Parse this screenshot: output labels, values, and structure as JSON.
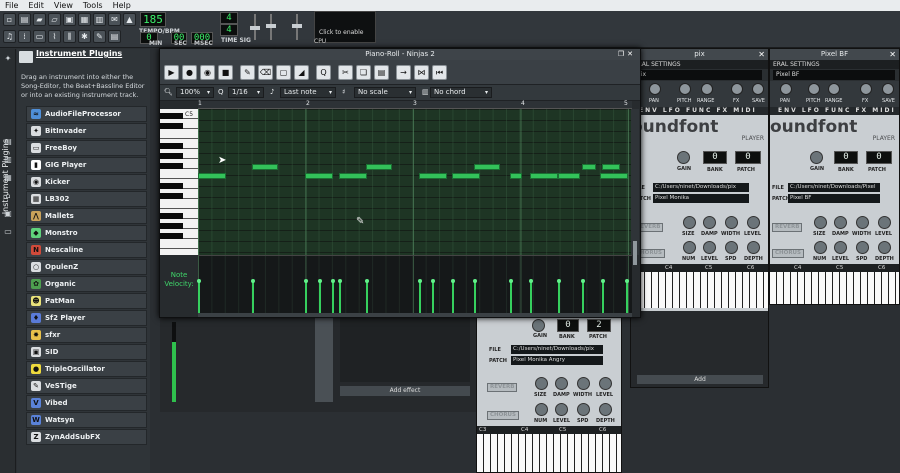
{
  "menu": [
    "File",
    "Edit",
    "View",
    "Tools",
    "Help"
  ],
  "transport": {
    "tempo": "185",
    "tempo_label": "TEMPO/BPM",
    "min": "0",
    "sec": "00",
    "msec": "000",
    "min_label": "MIN",
    "sec_label": "SEC",
    "msec_label": "MSEC",
    "timesig_num": "4",
    "timesig_den": "4",
    "timesig_label": "TIME SIG",
    "cpu_label": "CPU",
    "cpu_hint": "Click to enable"
  },
  "sidebar": {
    "tab_label": "Instrument Plugins"
  },
  "plugins": {
    "title": "Instrument Plugins",
    "description": "Drag an instrument into either the Song-Editor, the Beat+Bassline Editor or into an existing instrument track.",
    "items": [
      {
        "name": "AudioFileProcessor",
        "color": "#4f8fd8",
        "glyph": "≈"
      },
      {
        "name": "BitInvader",
        "color": "#dadde0",
        "glyph": "✦"
      },
      {
        "name": "FreeBoy",
        "color": "#dadde0",
        "glyph": "▭"
      },
      {
        "name": "GIG Player",
        "color": "#ffffff",
        "glyph": "▮"
      },
      {
        "name": "Kicker",
        "color": "#dadde0",
        "glyph": "◉"
      },
      {
        "name": "LB302",
        "color": "#dadde0",
        "glyph": "▦"
      },
      {
        "name": "Mallets",
        "color": "#c9a25a",
        "glyph": "⋀"
      },
      {
        "name": "Monstro",
        "color": "#5fd27b",
        "glyph": "◆"
      },
      {
        "name": "Nescaline",
        "color": "#d04a3a",
        "glyph": "N"
      },
      {
        "name": "OpulenZ",
        "color": "#dadde0",
        "glyph": "○"
      },
      {
        "name": "Organic",
        "color": "#4d9f4f",
        "glyph": "✿"
      },
      {
        "name": "PatMan",
        "color": "#e9e27a",
        "glyph": "☻"
      },
      {
        "name": "Sf2 Player",
        "color": "#5a7bd8",
        "glyph": "♦"
      },
      {
        "name": "sfxr",
        "color": "#e8c14a",
        "glyph": "✸"
      },
      {
        "name": "SID",
        "color": "#dadde0",
        "glyph": "▣"
      },
      {
        "name": "TripleOscillator",
        "color": "#eeda3d",
        "glyph": "●"
      },
      {
        "name": "VeSTige",
        "color": "#dadde0",
        "glyph": "✎"
      },
      {
        "name": "Vibed",
        "color": "#5a82d8",
        "glyph": "V"
      },
      {
        "name": "Watsyn",
        "color": "#5a82d8",
        "glyph": "W"
      },
      {
        "name": "ZynAddSubFX",
        "color": "#dadde0",
        "glyph": "Z"
      }
    ]
  },
  "piano_roll": {
    "title": "Piano-Roll - Ninjas 2",
    "zoom": "100%",
    "quantize": "1/16",
    "note_length": "Last note",
    "scale": "No scale",
    "chord": "No chord",
    "ruler": [
      "1",
      "2",
      "3",
      "4",
      "5"
    ],
    "key_label": "C5",
    "velocity_label": "Note Velocity:"
  },
  "sf2_windows": [
    {
      "title": "pix",
      "file": "C:/Users/ninet/Downloads/pix",
      "patch": "Pixel Monika",
      "name": "pix"
    },
    {
      "title": "Pixel BF",
      "file": "C:/Users/ninet/Downloads/Pixel BF",
      "patch": "Pixel BF",
      "name": "Pixel BF"
    },
    {
      "title": "",
      "file": "C:/Users/ninet/Downloads/pix",
      "patch": "Pixel Monika Angry",
      "name": ""
    }
  ],
  "sf2": {
    "gen_settings": "ERAL SETTINGS",
    "logo": "oundfont",
    "logo_sub": "PLAYER",
    "knob_labels": [
      "PAN",
      "PITCH",
      "RANGE",
      "FX",
      "SAVE"
    ],
    "lcd_bank": "0",
    "lcd_patch": "0",
    "lcd_patch_2": "2",
    "gain": "GAIN",
    "bank": "BANK",
    "patch_label": "PATCH",
    "file_label": "FILE",
    "reverb": "REVERB",
    "chorus": "CHORUS",
    "rev_knobs": [
      "SIZE",
      "DAMP",
      "WIDTH",
      "LEVEL"
    ],
    "cho_knobs": [
      "NUM",
      "LEVEL",
      "SPD",
      "DEPTH"
    ],
    "kbd_labels": [
      "C4",
      "C5",
      "C6"
    ],
    "kbd_labels_3": [
      "C3",
      "C4",
      "C5",
      "C6"
    ],
    "tabs": "ENV LFO FUNC FX MIDI",
    "add_effect": "Add effect",
    "add": "Add"
  }
}
